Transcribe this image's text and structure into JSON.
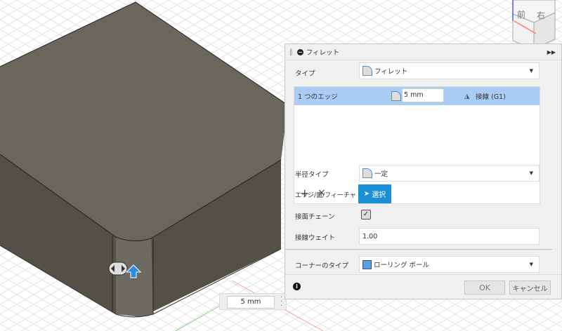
{
  "viewcube": {
    "front": "前",
    "right": "右"
  },
  "dimension_input": {
    "value": "5 mm"
  },
  "panel": {
    "title": "フィレット",
    "type_label": "タイプ",
    "type_value": "フィレット",
    "edge_row": {
      "label": "1 つのエッジ",
      "radius": "5 mm",
      "continuity": "接線 (G1)"
    },
    "add": "+",
    "remove": "×",
    "radius_type_label": "半径タイプ",
    "radius_type_value": "一定",
    "selection_label": "エッジ/面/フィーチャ",
    "selection_button": "選択",
    "tangent_chain_label": "接面チェーン",
    "tangent_chain_checked": true,
    "tangent_weight_label": "接線ウェイト",
    "tangent_weight_value": "1.00",
    "corner_type_label": "コーナーのタイプ",
    "corner_type_value": "ローリング ボール",
    "ok": "OK",
    "cancel": "キャンセル",
    "accent": "#1a8fd6"
  }
}
